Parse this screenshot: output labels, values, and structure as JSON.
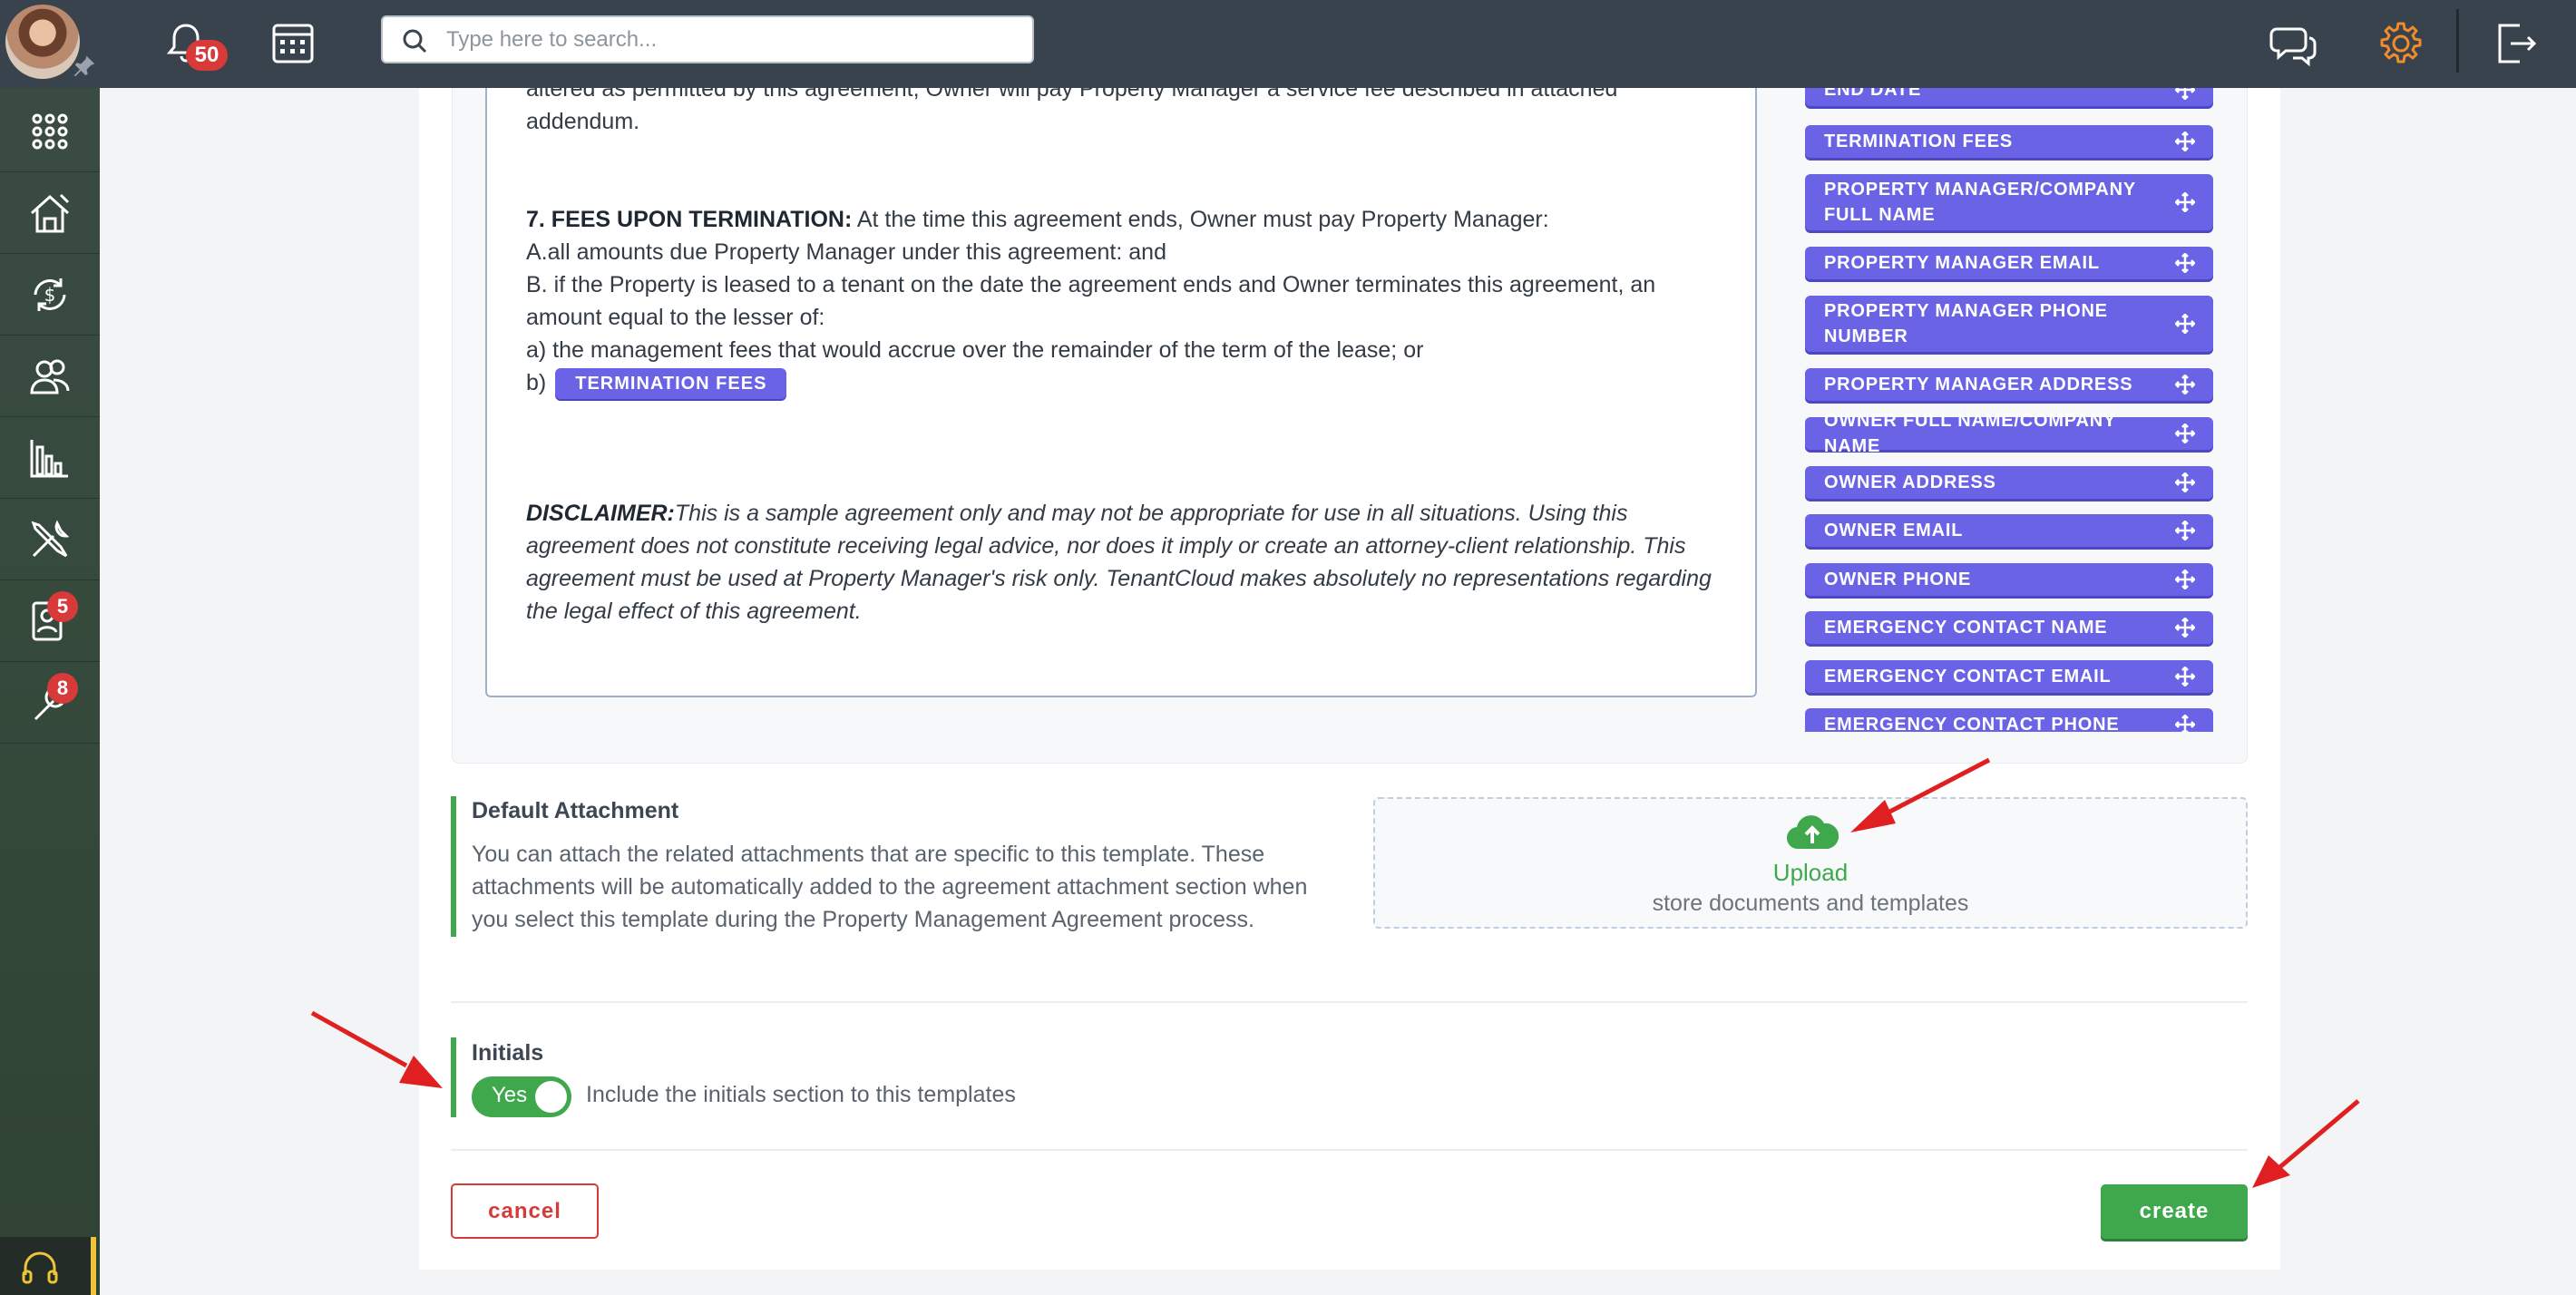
{
  "topbar": {
    "notifications_count": "50",
    "search_placeholder": "Type here to search..."
  },
  "sidebar": {
    "badges": {
      "applications": "5",
      "maintenance": "8"
    }
  },
  "document": {
    "line_top_1": "altered as permitted by this agreement, Owner will pay Property Manager a service fee described in attached",
    "line_top_2": "addendum.",
    "section7_title": "7. FEES UPON TERMINATION:",
    "section7_intro": " At the time this agreement ends, Owner must pay Property Manager:",
    "line_a": "A.all amounts due Property Manager under this agreement: and",
    "line_b1": "B. if the Property is leased to a tenant on the date the agreement ends and Owner terminates this agreement, an",
    "line_b2": "amount equal to the lesser of:",
    "line_a2": "a) the management fees that would accrue over the remainder of the term of the lease; or",
    "line_b_prefix": "b)",
    "inline_tag": "TERMINATION FEES",
    "disclaimer_label": "DISCLAIMER:",
    "disclaimer_1": "This is a sample agreement only and may not be appropriate for use in all situations. Using this",
    "disclaimer_2": "agreement does not constitute receiving legal advice, nor does it imply or create an attorney-client relationship. This",
    "disclaimer_3": "agreement must be used at Property Manager's risk only. TenantCloud makes absolutely no representations regarding",
    "disclaimer_4": "the legal effect of this agreement."
  },
  "fields": [
    "END DATE",
    "TERMINATION FEES",
    "PROPERTY MANAGER/COMPANY FULL NAME",
    "PROPERTY MANAGER EMAIL",
    "PROPERTY MANAGER PHONE NUMBER",
    "PROPERTY MANAGER ADDRESS",
    "OWNER FULL NAME/COMPANY NAME",
    "OWNER ADDRESS",
    "OWNER EMAIL",
    "OWNER PHONE",
    "EMERGENCY CONTACT NAME",
    "EMERGENCY CONTACT EMAIL",
    "EMERGENCY CONTACT PHONE"
  ],
  "attachment": {
    "title": "Default Attachment",
    "desc_1": "You can attach the related attachments that are specific to this template. These",
    "desc_2": "attachments will be automatically added to the agreement attachment section when",
    "desc_3": "you select this template during the Property Management Agreement process.",
    "upload_label": "Upload",
    "upload_sub": "store documents and templates"
  },
  "initials": {
    "title": "Initials",
    "toggle_label": "Yes",
    "desc": "Include the initials section to this templates"
  },
  "actions": {
    "cancel": "cancel",
    "create": "create"
  },
  "colors": {
    "topbar": "#39434d",
    "accent_green": "#3fa84c",
    "field_purple": "#6a63e6",
    "danger_red": "#d83a3a",
    "arrow_red": "#e02020",
    "settings_orange": "#f08c2a"
  }
}
